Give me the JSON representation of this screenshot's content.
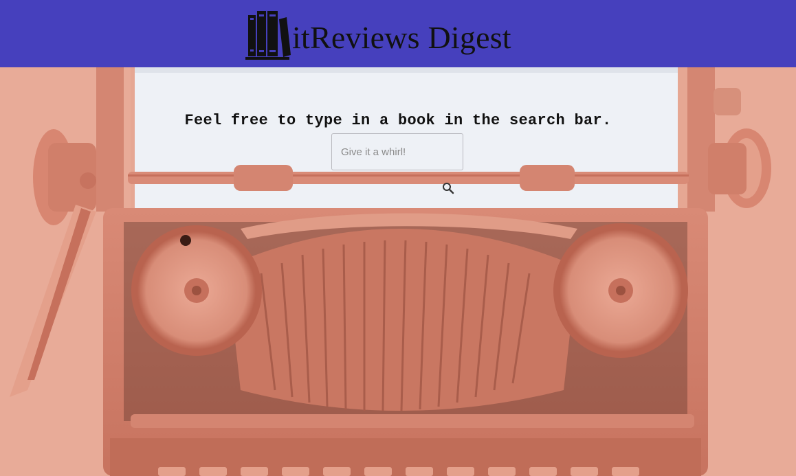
{
  "header": {
    "logo_text": "itReviews Digest",
    "background": "#4640bd"
  },
  "main": {
    "prompt": "Feel free to type in a book in the search bar.",
    "search": {
      "placeholder": "Give it a whirl!",
      "value": ""
    }
  },
  "icons": {
    "logo": "books-icon",
    "search": "search-icon"
  },
  "colors": {
    "accent": "#4640bd",
    "scene": "#e6a793",
    "paper": "#eef1f6"
  }
}
